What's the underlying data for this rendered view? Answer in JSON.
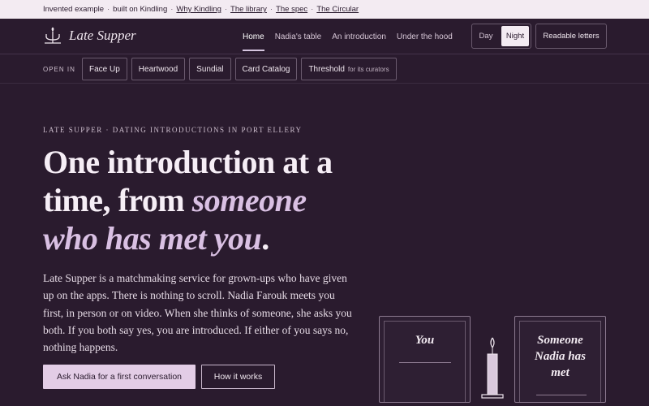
{
  "topbar": {
    "invented": "Invented example",
    "built": "built on Kindling",
    "links": [
      "Why Kindling",
      "The library",
      "The spec",
      "The Circular"
    ]
  },
  "brand": {
    "name": "Late Supper"
  },
  "nav": {
    "items": [
      "Home",
      "Nadia's table",
      "An introduction",
      "Under the hood"
    ],
    "active": "Home"
  },
  "theme": {
    "day": "Day",
    "night": "Night",
    "selected": "Night"
  },
  "readable": "Readable letters",
  "open_in": {
    "label": "OPEN IN",
    "chips": [
      {
        "label": "Face Up"
      },
      {
        "label": "Heartwood"
      },
      {
        "label": "Sundial"
      },
      {
        "label": "Card Catalog"
      },
      {
        "label": "Threshold",
        "note": "for its curators"
      }
    ]
  },
  "hero": {
    "eyebrow": "LATE SUPPER · DATING INTRODUCTIONS IN PORT ELLERY",
    "headline_plain": "One introduction at a time, from ",
    "headline_em": "someone who has met you",
    "headline_end": ".",
    "lede": "Late Supper is a matchmaking service for grown-ups who have given up on the apps. There is nothing to scroll. Nadia Farouk meets you first, in person or on video. When she thinks of someone, she asks you both. If you both say yes, you are introduced. If either of you says no, nothing happens.",
    "primary_cta": "Ask Nadia for a first conversation",
    "secondary_cta": "How it works"
  },
  "illustration": {
    "card_left": "You",
    "card_right": "Someone Nadia has met",
    "colors": {
      "card_border": "#8c7a90",
      "candle": "#d9c8dc"
    }
  }
}
